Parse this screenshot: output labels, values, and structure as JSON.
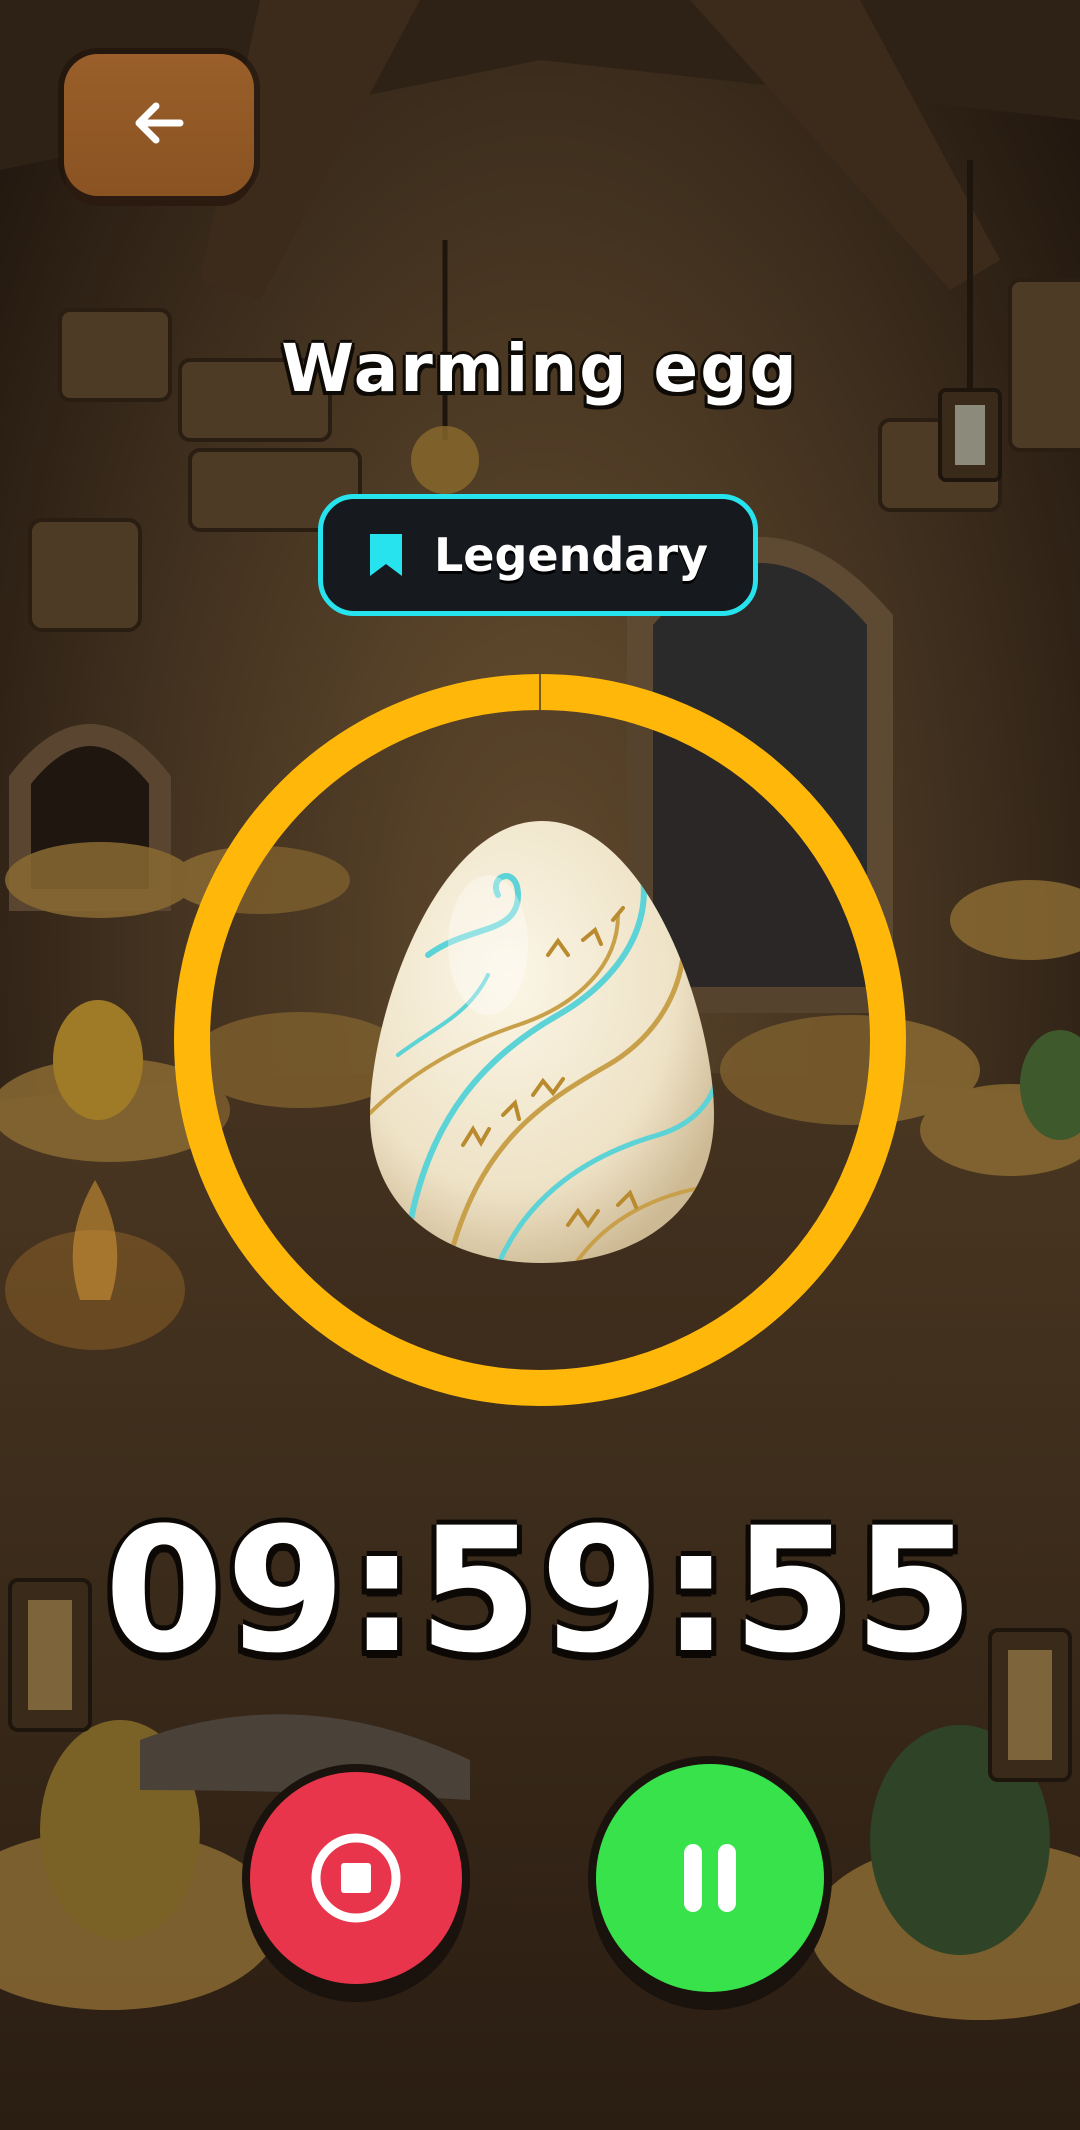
{
  "header": {
    "back_icon": "arrow-left-icon",
    "title": "Warming egg"
  },
  "rarity": {
    "icon": "bookmark-icon",
    "label": "Legendary",
    "accent": "#27e3ee"
  },
  "incubator": {
    "ring_color": "#ffb80a",
    "progress": 1.0,
    "egg_icon": "rune-egg-icon"
  },
  "timer": {
    "value": "09:59:55"
  },
  "controls": {
    "stop": {
      "icon": "stop-icon",
      "color": "#e8354b"
    },
    "pause": {
      "icon": "pause-icon",
      "color": "#37e24a"
    }
  }
}
